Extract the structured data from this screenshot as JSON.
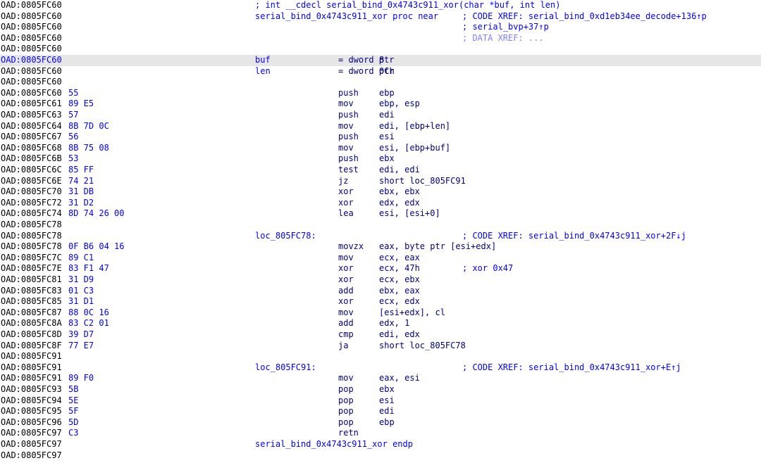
{
  "colors": {
    "background": "#ffffff",
    "address": "#000000",
    "highlighted_address": "#0000ff",
    "opcode_bytes": "#0000ff",
    "label": "#0000ff",
    "instruction": "#000080",
    "comment_xref": "#0000ff",
    "data_xref": "#8080ff",
    "highlight_row": "#e6e6e6"
  },
  "lines": [
    {
      "addr": "OAD:0805FC60",
      "header": "; int __cdecl serial_bind_0x4743c911_xor(char *buf, int len)"
    },
    {
      "addr": "OAD:0805FC60",
      "label": "serial_bind_0x4743c911_xor proc near",
      "comment": "; CODE XREF: serial_bind_0xd1eb34ee_decode+136↑p"
    },
    {
      "addr": "OAD:0805FC60",
      "comment": "; serial_bvp+37↑p"
    },
    {
      "addr": "OAD:0805FC60",
      "comment": "; DATA XREF: ..."
    },
    {
      "addr": "OAD:0805FC60"
    },
    {
      "addr": "OAD:0805FC60",
      "label": "buf",
      "mnem": "= dword ptr",
      "ops": "8"
    },
    {
      "addr": "OAD:0805FC60",
      "label": "len",
      "mnem": "= dword ptr",
      "ops": "0Ch"
    },
    {
      "addr": "OAD:0805FC60"
    },
    {
      "addr": "OAD:0805FC60",
      "bytes": "55",
      "mnem": "push",
      "ops": "ebp"
    },
    {
      "addr": "OAD:0805FC61",
      "bytes": "89 E5",
      "mnem": "mov",
      "ops": "ebp, esp"
    },
    {
      "addr": "OAD:0805FC63",
      "bytes": "57",
      "mnem": "push",
      "ops": "edi"
    },
    {
      "addr": "OAD:0805FC64",
      "bytes": "8B 7D 0C",
      "mnem": "mov",
      "ops": "edi, [ebp+len]"
    },
    {
      "addr": "OAD:0805FC67",
      "bytes": "56",
      "mnem": "push",
      "ops": "esi"
    },
    {
      "addr": "OAD:0805FC68",
      "bytes": "8B 75 08",
      "mnem": "mov",
      "ops": "esi, [ebp+buf]"
    },
    {
      "addr": "OAD:0805FC6B",
      "bytes": "53",
      "mnem": "push",
      "ops": "ebx"
    },
    {
      "addr": "OAD:0805FC6C",
      "bytes": "85 FF",
      "mnem": "test",
      "ops": "edi, edi"
    },
    {
      "addr": "OAD:0805FC6E",
      "bytes": "74 21",
      "mnem": "jz",
      "ops": "short loc_805FC91"
    },
    {
      "addr": "OAD:0805FC70",
      "bytes": "31 DB",
      "mnem": "xor",
      "ops": "ebx, ebx"
    },
    {
      "addr": "OAD:0805FC72",
      "bytes": "31 D2",
      "mnem": "xor",
      "ops": "edx, edx"
    },
    {
      "addr": "OAD:0805FC74",
      "bytes": "8D 74 26 00",
      "mnem": "lea",
      "ops": "esi, [esi+0]"
    },
    {
      "addr": "OAD:0805FC78"
    },
    {
      "addr": "OAD:0805FC78",
      "label": "loc_805FC78:",
      "comment": "; CODE XREF: serial_bind_0x4743c911_xor+2F↓j"
    },
    {
      "addr": "OAD:0805FC78",
      "bytes": "0F B6 04 16",
      "mnem": "movzx",
      "ops": "eax, byte ptr [esi+edx]"
    },
    {
      "addr": "OAD:0805FC7C",
      "bytes": "89 C1",
      "mnem": "mov",
      "ops": "ecx, eax"
    },
    {
      "addr": "OAD:0805FC7E",
      "bytes": "83 F1 47",
      "mnem": "xor",
      "ops": "ecx, 47h",
      "comment": "; xor 0x47"
    },
    {
      "addr": "OAD:0805FC81",
      "bytes": "31 D9",
      "mnem": "xor",
      "ops": "ecx, ebx"
    },
    {
      "addr": "OAD:0805FC83",
      "bytes": "01 C3",
      "mnem": "add",
      "ops": "ebx, eax"
    },
    {
      "addr": "OAD:0805FC85",
      "bytes": "31 D1",
      "mnem": "xor",
      "ops": "ecx, edx"
    },
    {
      "addr": "OAD:0805FC87",
      "bytes": "88 0C 16",
      "mnem": "mov",
      "ops": "[esi+edx], cl"
    },
    {
      "addr": "OAD:0805FC8A",
      "bytes": "83 C2 01",
      "mnem": "add",
      "ops": "edx, 1"
    },
    {
      "addr": "OAD:0805FC8D",
      "bytes": "39 D7",
      "mnem": "cmp",
      "ops": "edi, edx"
    },
    {
      "addr": "OAD:0805FC8F",
      "bytes": "77 E7",
      "mnem": "ja",
      "ops": "short loc_805FC78"
    },
    {
      "addr": "OAD:0805FC91"
    },
    {
      "addr": "OAD:0805FC91",
      "label": "loc_805FC91:",
      "comment": "; CODE XREF: serial_bind_0x4743c911_xor+E↑j"
    },
    {
      "addr": "OAD:0805FC91",
      "bytes": "89 F0",
      "mnem": "mov",
      "ops": "eax, esi"
    },
    {
      "addr": "OAD:0805FC93",
      "bytes": "5B",
      "mnem": "pop",
      "ops": "ebx"
    },
    {
      "addr": "OAD:0805FC94",
      "bytes": "5E",
      "mnem": "pop",
      "ops": "esi"
    },
    {
      "addr": "OAD:0805FC95",
      "bytes": "5F",
      "mnem": "pop",
      "ops": "edi"
    },
    {
      "addr": "OAD:0805FC96",
      "bytes": "5D",
      "mnem": "pop",
      "ops": "ebp"
    },
    {
      "addr": "OAD:0805FC97",
      "bytes": "C3",
      "mnem": "retn"
    },
    {
      "addr": "OAD:0805FC97",
      "label": "serial_bind_0x4743c911_xor endp"
    },
    {
      "addr": "OAD:0805FC97"
    }
  ]
}
